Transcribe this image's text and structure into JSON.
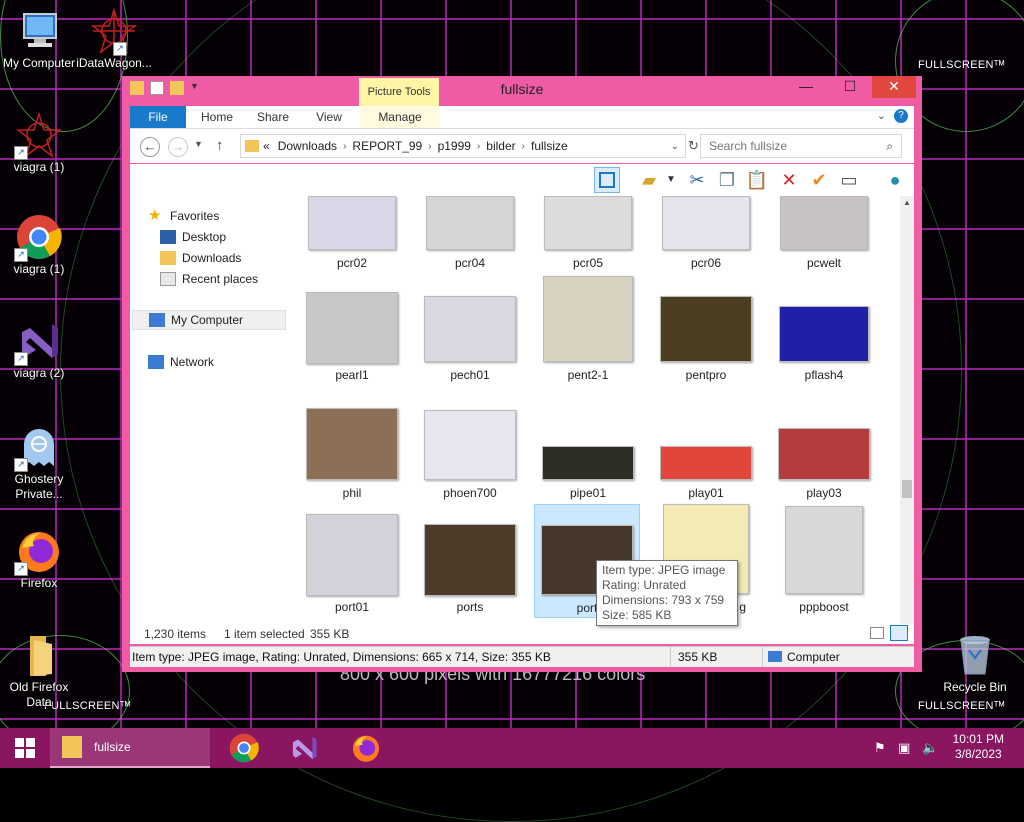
{
  "desktop": {
    "icons": [
      {
        "label": "My Computer",
        "icon": "computer-icon"
      },
      {
        "label": "iDataWagon...",
        "icon": "red-star-icon"
      },
      {
        "label": "viagra (1)",
        "icon": "red-star-icon"
      },
      {
        "label": "viagra (1)",
        "icon": "chrome-icon"
      },
      {
        "label": "viagra (2)",
        "icon": "visual-studio-icon"
      },
      {
        "label": "Ghostery Private...",
        "icon": "ghostery-icon"
      },
      {
        "label": "Firefox",
        "icon": "firefox-icon"
      },
      {
        "label": "Old Firefox Data",
        "icon": "folder-icon"
      },
      {
        "label": "Recycle Bin",
        "icon": "recycle-bin-icon"
      }
    ],
    "wallpaper_texts": {
      "fullscreen_tr": "FULLSCREENᵀᴹ",
      "fullscreen_br": "FULLSCREENᵀᴹ",
      "fullscreen_bl": "FULLSCREENᵀᴹ",
      "bottom_center": "800 x 600 pixels with 16777216 colors"
    }
  },
  "window": {
    "title": "fullsize",
    "context_tab": "Picture Tools",
    "ribbon_tabs": [
      "File",
      "Home",
      "Share",
      "View",
      "Manage"
    ],
    "breadcrumb": [
      "Downloads",
      "REPORT_99",
      "p1999",
      "bilder",
      "fullsize"
    ],
    "breadcrumb_prefix": "«",
    "search_placeholder": "Search fullsize",
    "nav": {
      "favorites": "Favorites",
      "favorites_items": [
        "Desktop",
        "Downloads",
        "Recent places"
      ],
      "my_computer": "My Computer",
      "network": "Network"
    },
    "files": [
      {
        "name": "pcr02"
      },
      {
        "name": "pcr04"
      },
      {
        "name": "pcr05"
      },
      {
        "name": "pcr06"
      },
      {
        "name": "pcwelt"
      },
      {
        "name": "pearl1"
      },
      {
        "name": "pech01"
      },
      {
        "name": "pent2-1"
      },
      {
        "name": "pentpro"
      },
      {
        "name": "pflash4"
      },
      {
        "name": "phil"
      },
      {
        "name": "phoen700"
      },
      {
        "name": "pipe01"
      },
      {
        "name": "play01"
      },
      {
        "name": "play03"
      },
      {
        "name": "port01"
      },
      {
        "name": "ports"
      },
      {
        "name": "port"
      },
      {
        "name": "g"
      },
      {
        "name": "pppboost"
      }
    ],
    "status": {
      "item_count": "1,230 items",
      "selection": "1 item selected",
      "selection_size": "355 KB"
    },
    "details_bar": {
      "info": "Item type: JPEG image, Rating: Unrated, Dimensions: 665 x 714, Size: 355 KB",
      "size": "355 KB",
      "location": "Computer"
    },
    "tooltip": {
      "type": "Item type: JPEG image",
      "rating": "Rating: Unrated",
      "dimensions": "Dimensions: 793 x 759",
      "size": "Size: 585 KB"
    }
  },
  "taskbar": {
    "active_app": "fullsize",
    "time": "10:01 PM",
    "date": "3/8/2023"
  },
  "colors": {
    "window_frame": "#f05ca4",
    "taskbar": "#8a1560",
    "accent_blue": "#1979ca",
    "selection": "#cce8ff"
  }
}
